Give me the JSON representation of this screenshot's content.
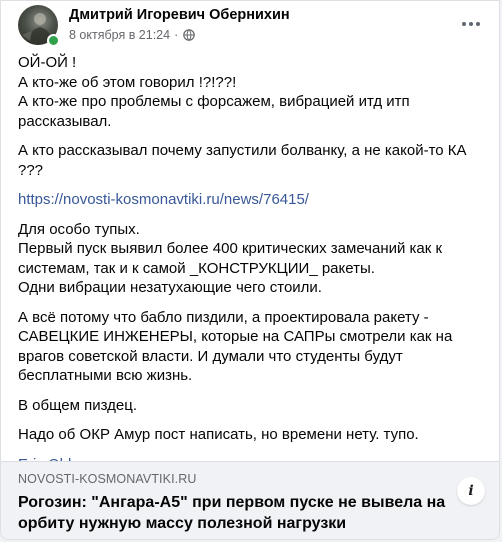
{
  "post": {
    "author": "Дмитрий Игоревич Обернихин",
    "timestamp": "8 октября в 21:24",
    "separator": "·",
    "privacy_icon": "globe-icon",
    "more_icon": "more-options-icon",
    "body": {
      "p1": [
        "ОЙ-ОЙ !",
        "А кто-же об этом говорил !?!??!",
        "А кто-же про проблемы с форсажем, вибрацией итд итп рассказывал."
      ],
      "p2": "А кто рассказывал почему запустили болванку, а не какой-то КА ???",
      "link": "https://novosti-kosmonavtiki.ru/news/76415/",
      "p3": [
        "Для особо тупых.",
        "Первый пуск выявил более 400 критических замечаний как к системам, так и к самой _КОНСТРУКЦИИ_ ракеты.",
        "Одни вибрации незатухающие чего стоили."
      ],
      "p4": "А всё потому что бабло пиздили, а проектировала ракету - САВЕЦКИЕ ИНЖЕНЕРЫ, которые на САПРы смотрели как на врагов советской власти. И думали что студенты будут бесплатными всю жизнь.",
      "p5": "В общем пиздец.",
      "p6": "Надо об ОКР Амур пост написать, но времени нету. тупо.",
      "tag": "Eric Oldmann"
    },
    "preview": {
      "domain": "NOVOSTI-KOSMONAVTIKI.RU",
      "title": "Рогозин: \"Ангара-А5\" при первом пуске не вывела на орбиту нужную массу полезной нагрузки",
      "info_icon": "i"
    }
  },
  "colors": {
    "link": "#385898",
    "online": "#31a24c",
    "preview_bg": "#f0f2f5"
  }
}
